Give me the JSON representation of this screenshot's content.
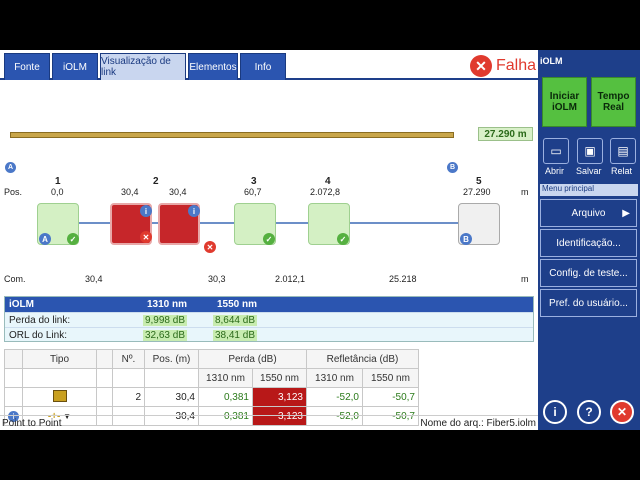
{
  "tabs": [
    "Fonte",
    "iOLM",
    "Visualização de link",
    "Elementos",
    "Info"
  ],
  "status_fail": "Falha",
  "total_length": "27.290 m",
  "endpoints": {
    "a": "A",
    "b": "B"
  },
  "events": [
    {
      "n": "1",
      "pos": "0,0",
      "com": "30,4"
    },
    {
      "n": "2",
      "pos_left": "30,4",
      "pos_right": "30,4",
      "com": "30,3"
    },
    {
      "n": "3",
      "pos": "60,7",
      "com": "2.012,1"
    },
    {
      "n": "4",
      "pos": "2.072,8",
      "com": "25.218"
    },
    {
      "n": "5",
      "pos": "27.290"
    }
  ],
  "pos_label": "Pos.",
  "com_label": "Com.",
  "unit_m": "m",
  "summary": {
    "title": "iOLM",
    "col1": "1310 nm",
    "col2": "1550 nm",
    "rows": [
      {
        "label": "Perda do link:",
        "v1": "9,998 dB",
        "v2": "8,644 dB"
      },
      {
        "label": "ORL do Link:",
        "v1": "32,63 dB",
        "v2": "38,41 dB"
      }
    ]
  },
  "table": {
    "headers": {
      "tipo": "Tipo",
      "no": "Nº.",
      "pos": "Pos. (m)",
      "perda": "Perda (dB)",
      "refl": "Refletância (dB)",
      "w1": "1310 nm",
      "w2": "1550 nm"
    },
    "rows": [
      {
        "no": "2",
        "pos": "30,4",
        "p1": "0,381",
        "p2": "3,123",
        "r1": "-52,0",
        "r2": "-50,7"
      },
      {
        "no": "",
        "pos": "30,4",
        "p1": "0,381",
        "p2": "3,123",
        "r1": "-52,0",
        "r2": "-50,7"
      }
    ]
  },
  "status_left": "Point to Point",
  "status_right": "Nome do arq.: Fiber5.iolm",
  "sidebar": {
    "title": "iOLM",
    "btn_start": "Iniciar iOLM",
    "btn_realtime": "Tempo Real",
    "icons": [
      {
        "label": "Abrir"
      },
      {
        "label": "Salvar"
      },
      {
        "label": "Relat"
      }
    ],
    "menu_header": "Menu principal",
    "menu": [
      "Arquivo",
      "Identificação...",
      "Config. de teste...",
      "Pref. do usuário..."
    ]
  }
}
